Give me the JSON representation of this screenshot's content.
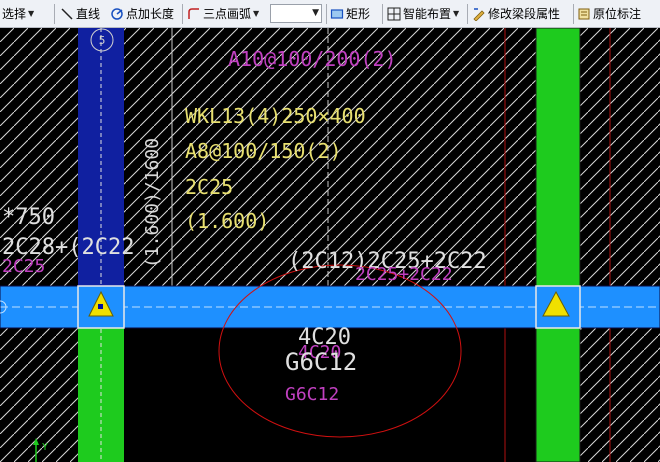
{
  "toolbar": {
    "select_label": "选择",
    "line_label": "直线",
    "point_length_label": "点加长度",
    "arc_label": "三点画弧",
    "combo_value": "",
    "rect_label": "矩形",
    "smart_layout_label": "智能布置",
    "modify_beam_label": "修改梁段属性",
    "origin_label_label": "原位标注"
  },
  "drawing": {
    "axis_bubble": "5",
    "stirrup_top": "A10@100/200(2)",
    "beam_name": "WKL13(4)250×400",
    "stirrup": "A8@100/150(2)",
    "top_bars": "2C25",
    "elevation": "(1.600)",
    "vertical_dim": "(1.600)/1600",
    "left_text_1": "*750",
    "left_text_2": "2C28+(2C22",
    "left_text_3": "2C25",
    "mid_text_1": "(2C12)2C25+2C22",
    "mid_text_2": "2C25+2C22",
    "bottom_bars": "4C20",
    "side_bars": "G6C12",
    "bottom_bars_ghost": "4C20",
    "side_bars_ghost": "G6C12",
    "y_axis_label": "Y"
  },
  "colors": {
    "beam_blue": "#1e90ff",
    "column_green": "#1ecb1e",
    "column_navy": "#1020a0",
    "text_yellow": "#e8e070",
    "text_magenta": "#c040c0",
    "ellipse_red": "#d01010"
  }
}
